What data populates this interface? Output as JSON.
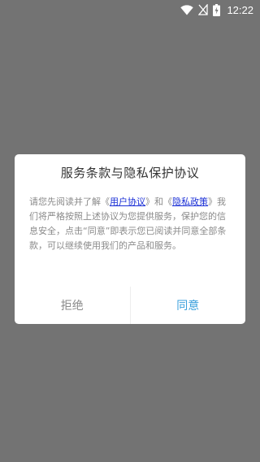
{
  "status_bar": {
    "time": "12:22",
    "icons": [
      "wifi-icon",
      "no-signal-icon",
      "battery-charging-icon"
    ]
  },
  "dialog": {
    "title": "服务条款与隐私保护协议",
    "body": {
      "text_1": "请您先阅读并了解《",
      "link_user_agreement": "用户协议",
      "text_2": "》和《",
      "link_privacy_policy": "隐私政策",
      "text_3": "》我们将严格按照上述协议为您提供服务，保护您的信息安全，点击“同意”即表示您已阅读并同意全部条款，可以继续使用我们的产品和服务。"
    },
    "buttons": {
      "reject_label": "拒绝",
      "agree_label": "同意"
    }
  },
  "colors": {
    "overlay": "#737373",
    "link": "#1a2fd6",
    "agree": "#3aa0dc",
    "reject": "#8a8a8a"
  }
}
